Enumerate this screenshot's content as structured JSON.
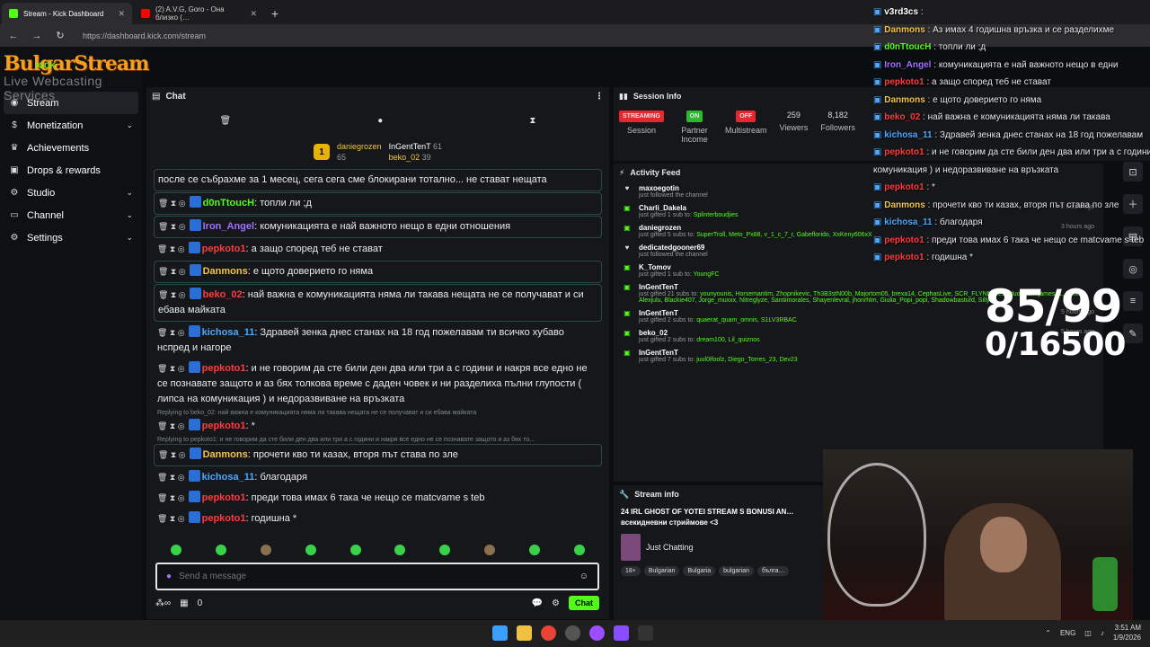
{
  "browser": {
    "tabs": [
      {
        "label": "Stream - Kick Dashboard",
        "color": "#53fc18"
      },
      {
        "label": "(2) A.V.G, Goro - Она близко (…",
        "color": "#ff0000"
      }
    ],
    "url": "https://dashboard.kick.com/stream"
  },
  "logo": {
    "main": "BulgarStream",
    "sub": "Live Webcasting Services",
    "kick": "KICK"
  },
  "sidebar": {
    "items": [
      {
        "label": "Stream",
        "icon": "stream-icon"
      },
      {
        "label": "Monetization",
        "icon": "dollar-icon"
      },
      {
        "label": "Achievements",
        "icon": "trophy-icon"
      },
      {
        "label": "Drops & rewards",
        "icon": "gift-icon"
      },
      {
        "label": "Studio",
        "icon": "gear-icon"
      },
      {
        "label": "Channel",
        "icon": "channel-icon"
      },
      {
        "label": "Settings",
        "icon": "settings-icon"
      }
    ]
  },
  "chat": {
    "title": "Chat",
    "leaderboard": [
      {
        "name": "daniegrozen",
        "value": "65",
        "rank": "1"
      },
      {
        "name": "InGentTenT",
        "value": "61"
      },
      {
        "name": "beko_02",
        "value": "39"
      }
    ],
    "messages": [
      {
        "user": "",
        "color": "#ffffff",
        "text": "после се събрахме за 1 месец, сега сега сме блокирани тотално... не стават нещата",
        "hl": true
      },
      {
        "user": "d0nTtoucH",
        "color": "#53fc18",
        "text": "топли ли ;д",
        "hl": true
      },
      {
        "user": "Iron_Angel",
        "color": "#a070ff",
        "text": "комуникацията е най важното нещо в едни отношения",
        "hl": true
      },
      {
        "user": "pepkoto1",
        "color": "#ff3b3b",
        "text": "а защо според теб не стават",
        "hl": false
      },
      {
        "user": "Danmons",
        "color": "#f4c542",
        "text": "е щото доверието го няма",
        "hl": true
      },
      {
        "user": "beko_02",
        "color": "#ff3b3b",
        "text": "най важна е комуникацията няма ли такава нещата не се получават и си ебава майката",
        "hl": true
      },
      {
        "user": "kichosa_11",
        "color": "#4aa8ff",
        "text": "Здравей зенка днес станах на 18 год пожелавам ти всичко хубаво нспред и нагоре",
        "hl": false
      },
      {
        "user": "pepkoto1",
        "color": "#ff3b3b",
        "text": "и не говорим да сте били ден два или три а с години и накря все едно не се познавате защото и аз бях толкова време с даден човек и ни разделиха пълни глупости ( липса на комуникация ) и недоразвиване на връзката",
        "hl": false
      },
      {
        "user": "pepkoto1",
        "color": "#ff3b3b",
        "text": "*",
        "hl": false,
        "reply": "Replying to beko_02: най важна е комуникацията няма ли такава нещата не се получават и си ебава майката"
      },
      {
        "user": "Danmons",
        "color": "#f4c542",
        "text": "прочети кво ти казах, вторя път става по зле",
        "hl": true,
        "reply": "Replying to pepkoto1: и не говорим да сте били ден два или три а с години и накря все едно не се познавате защото и аз бях то..."
      },
      {
        "user": "kichosa_11",
        "color": "#4aa8ff",
        "text": "благодаря",
        "hl": false
      },
      {
        "user": "pepkoto1",
        "color": "#ff3b3b",
        "text": "преди това имах 6 така че нещо се matcvame s teb",
        "hl": false
      },
      {
        "user": "pepkoto1",
        "color": "#ff3b3b",
        "text": "годишна *",
        "hl": false
      }
    ],
    "input_placeholder": "Send a message",
    "footer_count": "0",
    "send_label": "Chat"
  },
  "session": {
    "title": "Session Info",
    "stats": [
      {
        "pill": "STREAMING",
        "pill_color": "#e8262d",
        "label": "Session"
      },
      {
        "pill": "ON",
        "pill_color": "#2db82d",
        "label": "Partner Income"
      },
      {
        "pill": "OFF",
        "pill_color": "#e8262d",
        "label": "Multistream"
      },
      {
        "num": "259",
        "label": "Viewers"
      },
      {
        "num": "8,182",
        "label": "Followers"
      }
    ]
  },
  "feed": {
    "title": "Activity Feed",
    "items": [
      {
        "name": "maxoegotin",
        "sub": "just followed the channel",
        "extra": "",
        "time": "",
        "icon": "heart-icon"
      },
      {
        "name": "Charli_Dakela",
        "sub": "just gifted 1 sub to:",
        "extra": "Splinterboudjies",
        "time": "2 hours ago",
        "icon": "gift-icon"
      },
      {
        "name": "daniegrozen",
        "sub": "just gifted 5 subs to:",
        "extra": "SuperTroll, Meto_Px88, v_1_c_7_r, Gabeflorido, XxKeny606xX",
        "time": "3 hours ago",
        "icon": "gift-icon"
      },
      {
        "name": "dedicatedgooner69",
        "sub": "just followed the channel",
        "extra": "",
        "time": "",
        "icon": "heart-icon"
      },
      {
        "name": "K_Tomov",
        "sub": "just gifted 1 sub to:",
        "extra": "YoungFC",
        "time": "",
        "icon": "gift-icon"
      },
      {
        "name": "InGentTenT",
        "sub": "just gifted 21 subs to:",
        "extra": "younyounis, Horsemantim, Zhopnikevic, Th3B3stN00b, Majortom05, brexa14, CephasLive, SCR_FLYNN, Testyduo, hawkjames_1, Perkiz, Alexjulu, Blackie407, Jorge_muxxx, Nitreglyze, Santiimorales, Shayenlevral, jhonrhlm, Giulia_Popi_popi, Shadowbasturd, Silly",
        "time": "",
        "icon": "gift-icon"
      },
      {
        "name": "InGentTenT",
        "sub": "just gifted 2 subs to:",
        "extra": "quaerat_quam_omnis, S1LV3RBAC",
        "time": "5 hours ago",
        "icon": "gift-icon"
      },
      {
        "name": "beko_02",
        "sub": "just gifted 2 subs to:",
        "extra": "dream100, Lil_quiznos",
        "time": "5 hours ago",
        "icon": "gift-icon"
      },
      {
        "name": "InGentTenT",
        "sub": "just gifted 7 subs to:",
        "extra": "juul0ifoolz, Diego_Torres_23, Dev23",
        "time": "",
        "icon": "gift-icon"
      }
    ]
  },
  "stream_info": {
    "title": "Stream info",
    "stream_title": "24 IRL GHOST OF YOTEI STREAM S BONUSI AN… всекидневни стриймове <3",
    "category": "Just Chatting",
    "tags": [
      "18+",
      "Bulgarian",
      "Bulgaria",
      "bulgarian",
      "бълга…"
    ]
  },
  "overlay": {
    "lines": [
      {
        "user": "v3rd3cs",
        "color": "#ffffff",
        "text": ""
      },
      {
        "user": "Danmons",
        "color": "#f4c542",
        "text": "Аз имах 4 годишна връзка и се разделихме"
      },
      {
        "user": "d0nTtoucH",
        "color": "#53fc18",
        "text": "топли ли ;д"
      },
      {
        "user": "Iron_Angel",
        "color": "#a070ff",
        "text": "комуникацията е най важното нещо в едни"
      },
      {
        "user": "pepkoto1",
        "color": "#ff3b3b",
        "text": "а защо според теб не стават"
      },
      {
        "user": "Danmons",
        "color": "#f4c542",
        "text": "е щото доверието го няма"
      },
      {
        "user": "beko_02",
        "color": "#ff3b3b",
        "text": "най важна е комуникацията няма ли такава"
      },
      {
        "user": "kichosa_11",
        "color": "#4aa8ff",
        "text": "Здравей зенка днес станах на 18 год пожелавам"
      },
      {
        "user": "pepkoto1",
        "color": "#ff3b3b",
        "text": "и не говорим да сте били ден два или три а с години"
      },
      {
        "user": "",
        "color": "#ffffff",
        "text": "комуникация ) и недоразвиване на връзката"
      },
      {
        "user": "pepkoto1",
        "color": "#ff3b3b",
        "text": "*"
      },
      {
        "user": "Danmons",
        "color": "#f4c542",
        "text": "прочети кво ти казах, вторя път става по зле"
      },
      {
        "user": "kichosa_11",
        "color": "#4aa8ff",
        "text": "благодаря"
      },
      {
        "user": "pepkoto1",
        "color": "#ff3b3b",
        "text": "преди това имах 6 така че нещо се matcvame s teb"
      },
      {
        "user": "pepkoto1",
        "color": "#ff3b3b",
        "text": "годишна *"
      }
    ],
    "counter_top": "85/99",
    "counter_bottom": "0/16500"
  },
  "taskbar": {
    "lang": "ENG",
    "time": "3:51 AM",
    "date": "1/9/2026"
  }
}
